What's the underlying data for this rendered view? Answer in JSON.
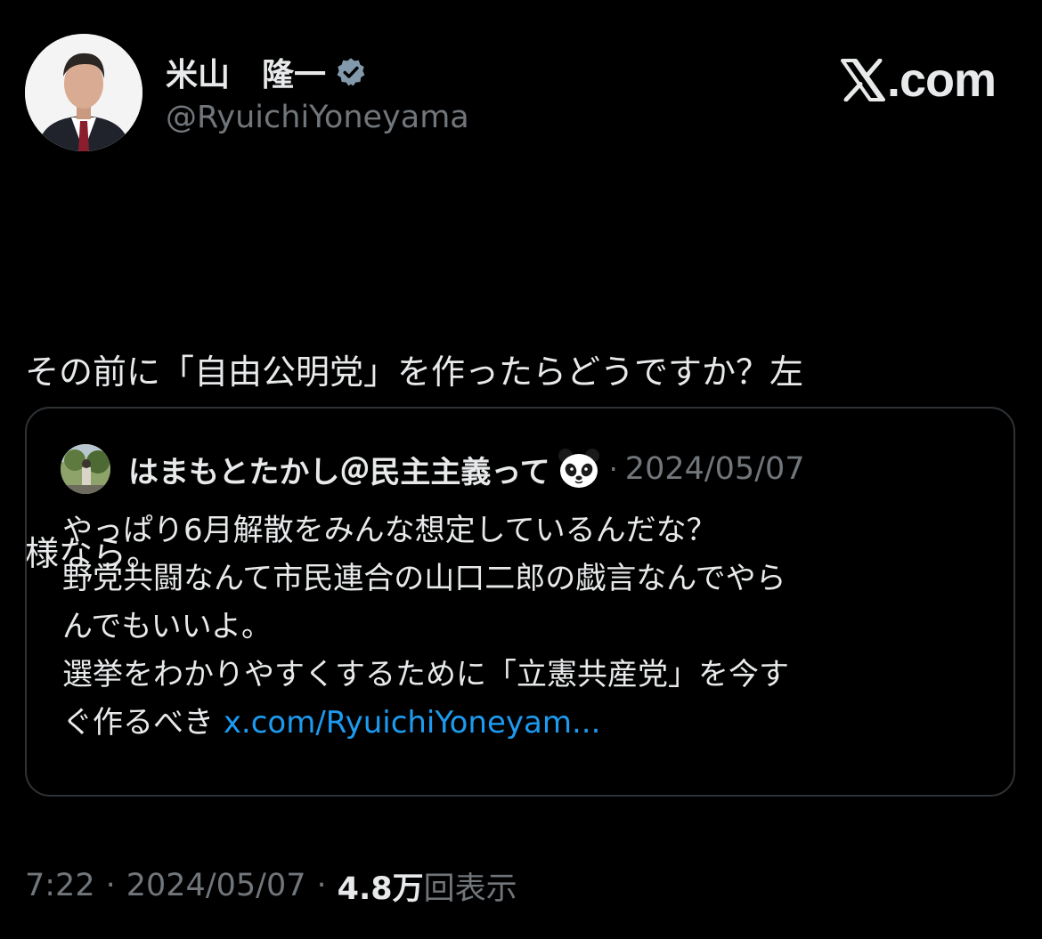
{
  "author": {
    "display_name": "米山　隆一",
    "handle": "@RyuichiYoneyama",
    "verified_icon": "verified-badge-icon"
  },
  "brand": {
    "label": ".com",
    "icon": "x-logo-icon"
  },
  "tweet": {
    "text_line_1": "その前に「自由公明党」を作ったらどうですか？左",
    "text_line_2": "様なら。"
  },
  "quote": {
    "author_name": "はまもとたかし＠民主主義って",
    "emoji": "panda-face",
    "separator": "·",
    "date": "2024/05/07",
    "lines": [
      "やっぱり6月解散をみんな想定しているんだな？",
      "野党共闘なんて市民連合の山口二郎の戯言なんでやら",
      "んでもいいよ。",
      "選挙をわかりやすくするために「立憲共産党」を今す",
      "ぐ作るべき "
    ],
    "link_text": "x.com/RyuichiYoneyam..."
  },
  "meta": {
    "time": "7:22",
    "separator": "·",
    "date": "2024/05/07",
    "views_count": "4.8万",
    "views_label": "回表示"
  },
  "colors": {
    "background": "#000000",
    "text_primary": "#e7e9ea",
    "text_secondary": "#71767b",
    "link": "#1d9bf0",
    "border": "#2f3336",
    "verified_badge": "#829aab"
  }
}
